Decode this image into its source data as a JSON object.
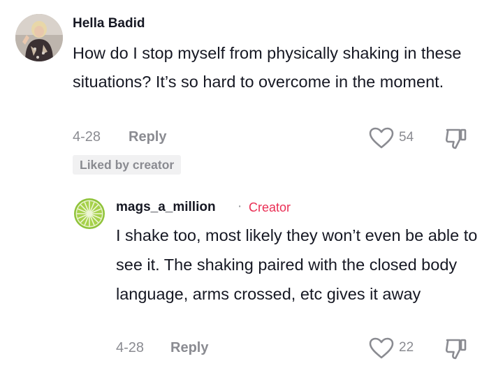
{
  "comments": [
    {
      "username": "Hella Badid",
      "text": "How do I stop myself from physically shaking in these situations? It’s so hard to overcome in the moment.",
      "date": "4-28",
      "reply_label": "Reply",
      "likes": "54",
      "badge": "Liked by creator",
      "avatar": "profile-photo"
    },
    {
      "username": "mags_a_million",
      "separator": "·",
      "creator_label": "Creator",
      "text": "I shake too, most likely they won’t even be able to see it. The shaking paired with the closed body language, arms crossed, etc gives it away",
      "date": "4-28",
      "reply_label": "Reply",
      "likes": "22",
      "avatar": "lime-slice"
    }
  ],
  "icons": {
    "like": "heart-outline-icon",
    "dislike": "thumbs-down-icon"
  },
  "colors": {
    "text": "#161823",
    "muted": "#8a8b91",
    "creator": "#ea2f55",
    "badge_bg": "#f1f1f2"
  }
}
